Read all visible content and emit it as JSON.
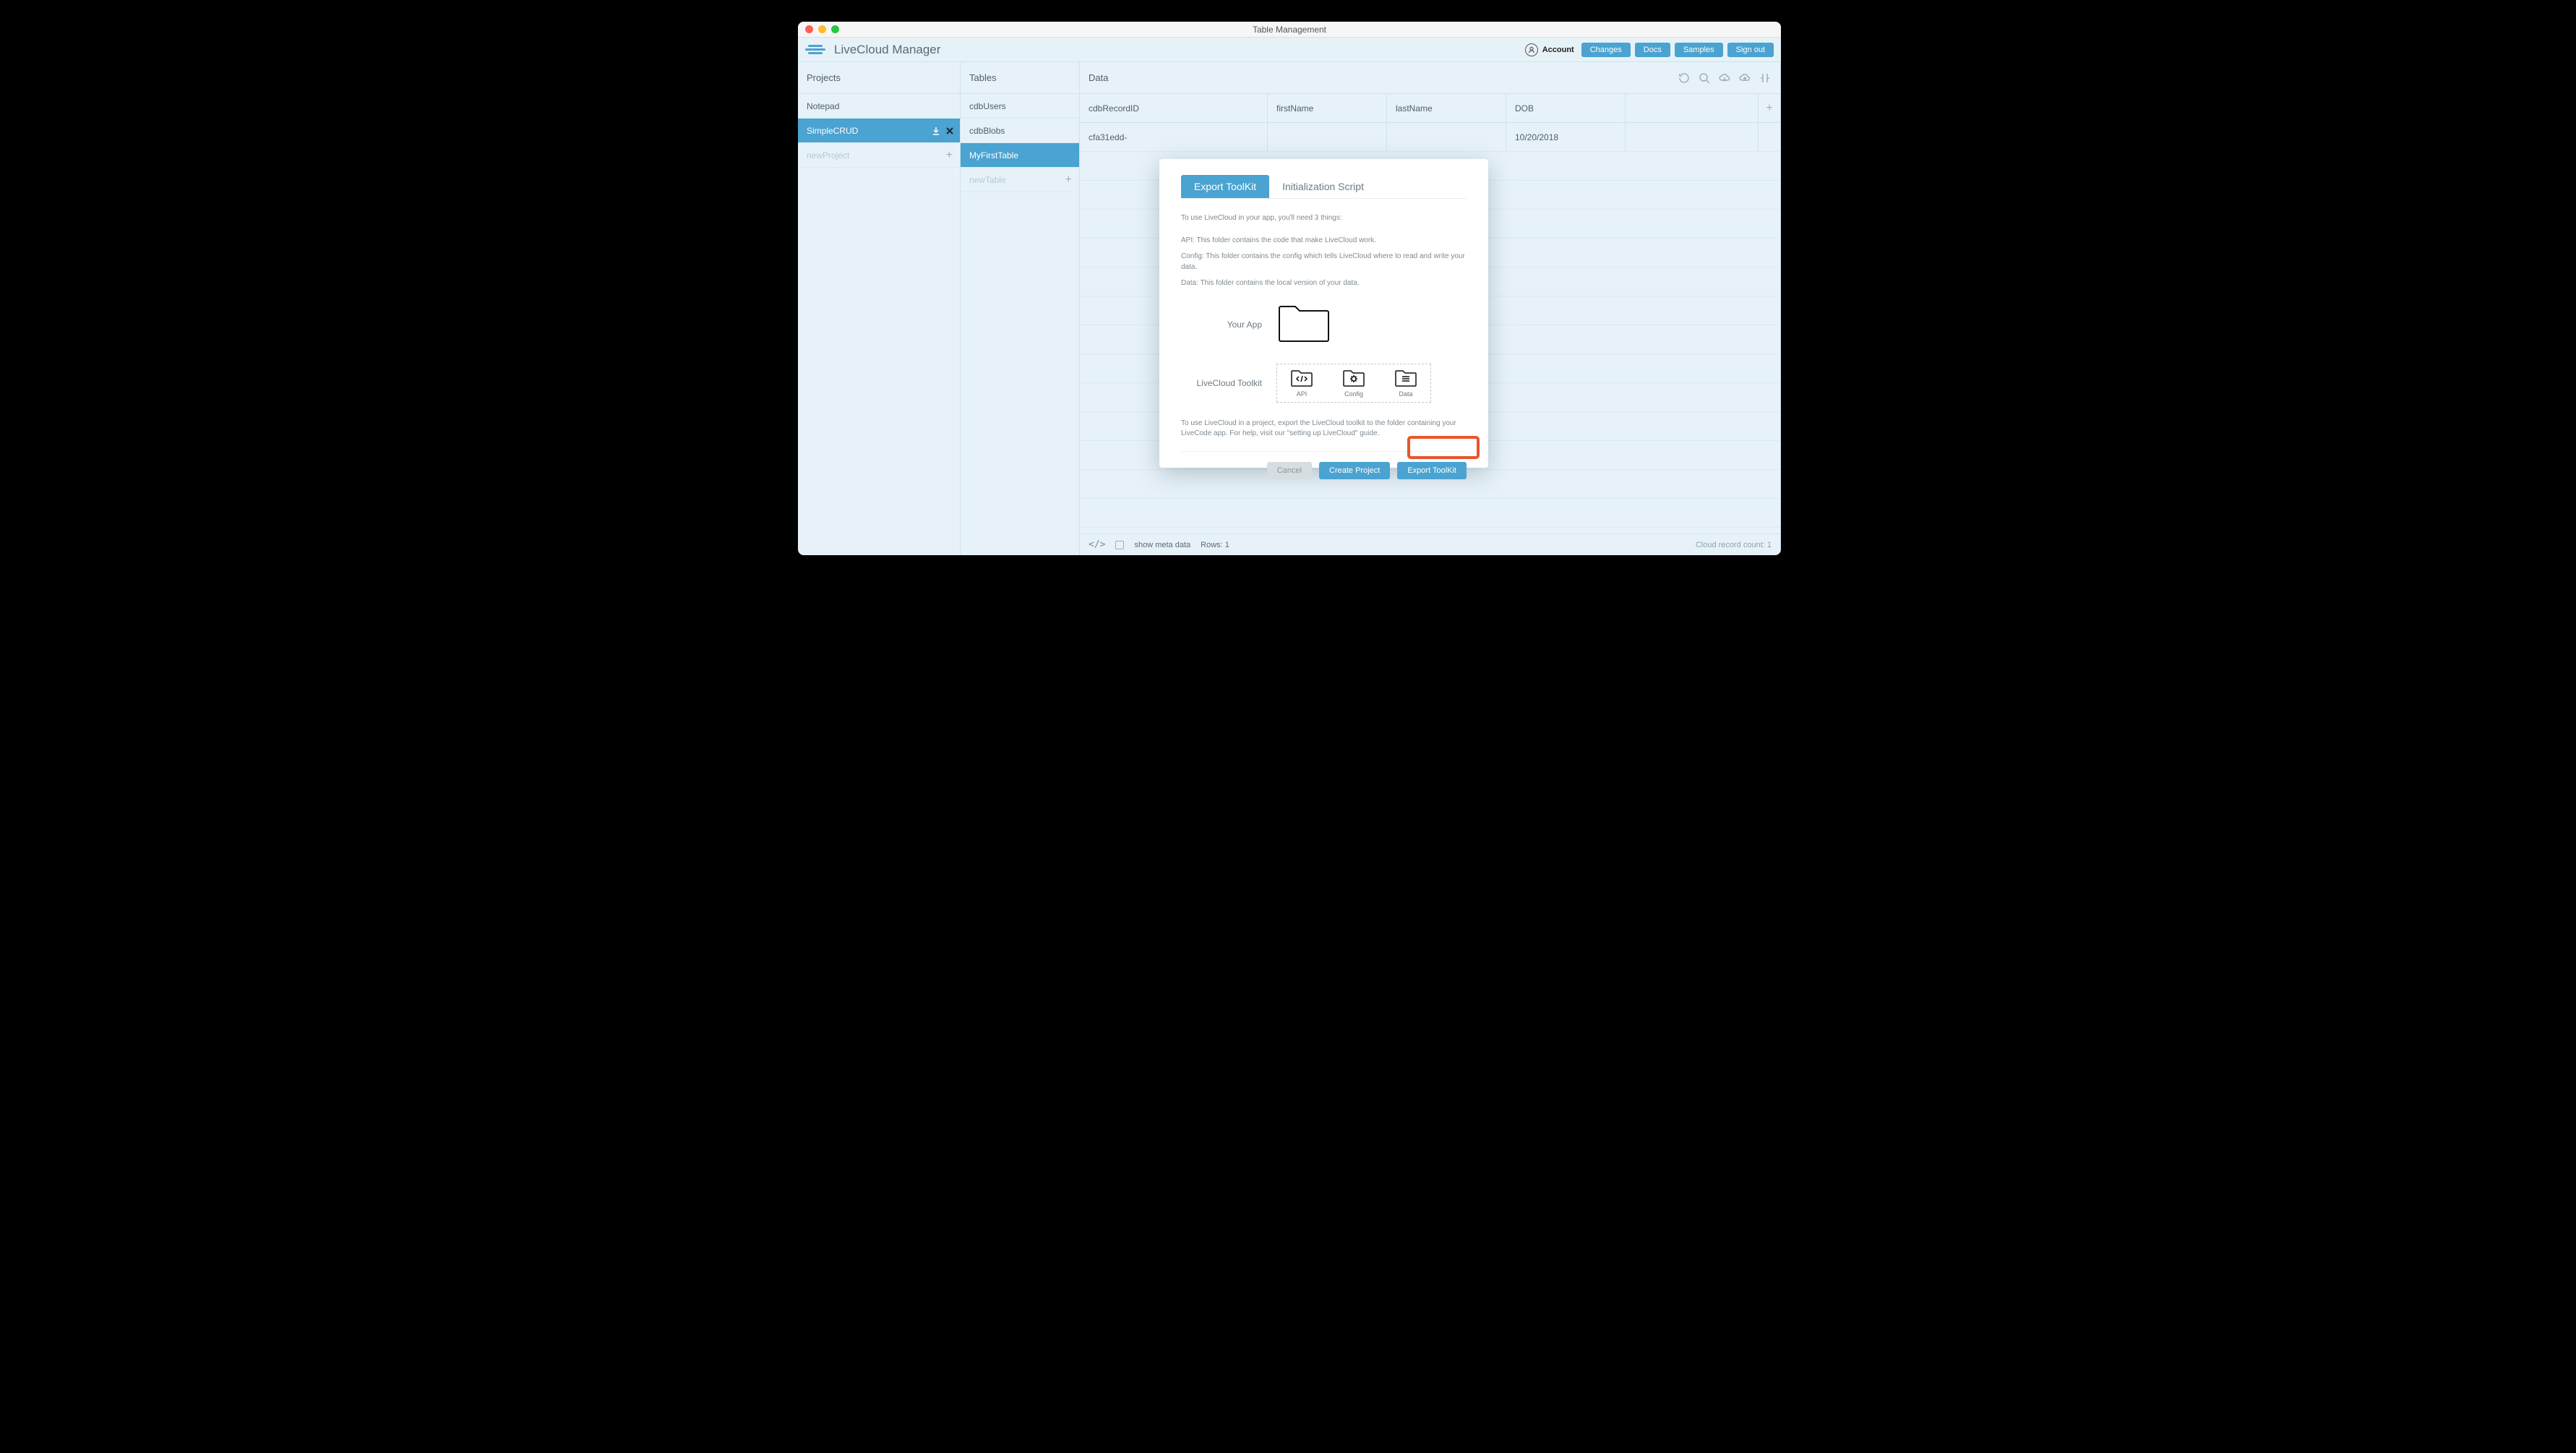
{
  "window": {
    "title": "Table Management"
  },
  "header": {
    "app_name": "LiveCloud Manager",
    "account_label": "Account",
    "buttons": {
      "changes": "Changes",
      "docs": "Docs",
      "samples": "Samples",
      "signout": "Sign out"
    }
  },
  "cols": {
    "projects_head": "Projects",
    "tables_head": "Tables",
    "data_head": "Data"
  },
  "projects": [
    {
      "name": "Notepad",
      "selected": false,
      "faded": false,
      "closable": false
    },
    {
      "name": "SimpleCRUD",
      "selected": true,
      "faded": false,
      "closable": true
    },
    {
      "name": "newProject",
      "selected": false,
      "faded": true,
      "add": true
    }
  ],
  "tables": [
    {
      "name": "cdbUsers",
      "selected": false
    },
    {
      "name": "cdbBlobs",
      "selected": false
    },
    {
      "name": "MyFirstTable",
      "selected": true
    },
    {
      "name": "newTable",
      "selected": false,
      "faded": true,
      "add": true
    }
  ],
  "data_columns": [
    "cdbRecordID",
    "firstName",
    "lastName",
    "DOB"
  ],
  "data_rows": [
    {
      "cdbRecordID": "cfa31edd-",
      "firstName": "",
      "lastName": "",
      "DOB": "10/20/2018"
    }
  ],
  "footer": {
    "show_meta": "show meta data",
    "rows_label": "Rows: 1",
    "cloud_count": "Cloud record count: 1"
  },
  "modal": {
    "tabs": {
      "export": "Export ToolKit",
      "init": "Initialization Script"
    },
    "intro": "To use LiveCloud in your app, you'll need 3 things:",
    "line_api": "API: This folder contains the code that make LiveCloud work.",
    "line_config": "Config: This folder contains the config which tells LiveCloud where to read and write your data.",
    "line_data": "Data: This folder contains the local version of your data.",
    "diag_your_app": "Your App",
    "diag_toolkit": "LiveCloud Toolkit",
    "tk_api": "API",
    "tk_config": "Config",
    "tk_data": "Data",
    "outro": "To use LiveCloud in a project, export the LiveCloud toolkit to the folder containing your LiveCode app. For help, visit our \"setting up LiveCloud\" guide.",
    "btn_cancel": "Cancel",
    "btn_create": "Create Project",
    "btn_export": "Export ToolKit"
  }
}
